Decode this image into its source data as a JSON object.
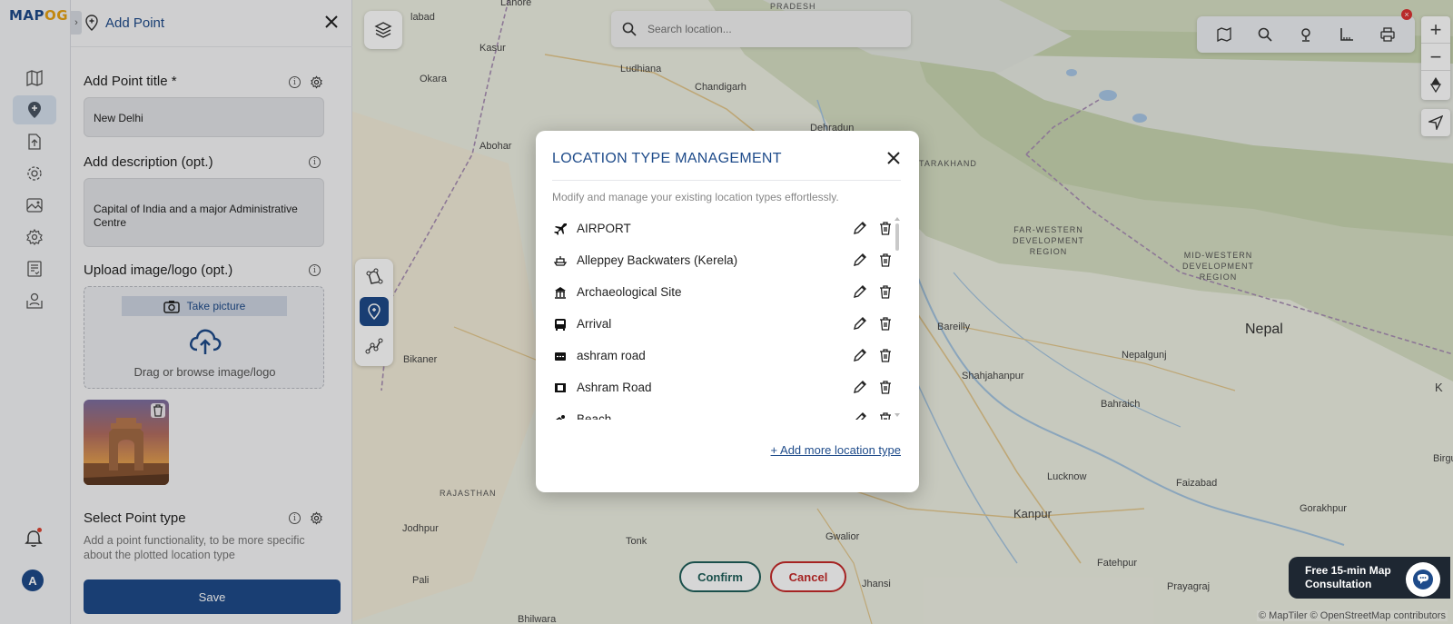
{
  "app": {
    "logo_main": "MAP",
    "logo_accent": "OG"
  },
  "rail": {
    "items": [
      {
        "name": "map-icon"
      },
      {
        "name": "add-point-icon"
      },
      {
        "name": "upload-icon"
      },
      {
        "name": "settings-icon"
      },
      {
        "name": "gallery-icon"
      },
      {
        "name": "preferences-icon"
      },
      {
        "name": "report-icon"
      },
      {
        "name": "map-user-icon"
      }
    ],
    "avatar_initial": "A"
  },
  "panel": {
    "title": "Add Point",
    "point_title_label": "Add Point title *",
    "point_title_value": "New Delhi",
    "description_label": "Add description (opt.)",
    "description_value": "Capital of India and a major Administrative Centre",
    "upload_label": "Upload image/logo (opt.)",
    "take_picture": "Take picture",
    "drag_browse": "Drag or browse image/logo",
    "point_type_label": "Select Point type",
    "point_type_note": "Add a point functionality, to be more specific about the plotted location type",
    "save_label": "Save"
  },
  "map": {
    "search_placeholder": "Search location...",
    "confirm_label": "Confirm",
    "cancel_label": "Cancel",
    "consult_line1": "Free 15-min Map",
    "consult_line2": "Consultation",
    "attribution": "© MapTiler © OpenStreetMap contributors",
    "places": {
      "lahore": "Lahore",
      "pradesh": "PRADESH",
      "faisalabad": "labad",
      "kasur": "Kasur",
      "ludhiana": "Ludhiana",
      "okara": "Okara",
      "chandigarh": "Chandigarh",
      "abohar": "Abohar",
      "dehradun": "Dehradun",
      "uttarakhand": "TARAKHAND",
      "far_western": "FAR-WESTERN\nDEVELOPMENT\nREGION",
      "mid_western": "MID-WESTERN\nDEVELOPMENT\nREGION",
      "nepal": "Nepal",
      "bareilly": "Bareilly",
      "nepalgunj": "Nepalgunj",
      "shahjahanpur": "Shahjahanpur",
      "bahraich": "Bahraich",
      "bikaner": "Bikaner",
      "rajasthan": "RAJASTHAN",
      "lucknow": "Lucknow",
      "faizabad": "Faizabad",
      "gorakhpur": "Gorakhpur",
      "birgunj": "Birgunj",
      "kanpur": "Kanpur",
      "jodhpur": "Jodhpur",
      "tonk": "Tonk",
      "gwalior": "Gwalior",
      "fatehpur": "Fatehpur",
      "pali": "Pali",
      "bhilwara": "Bhilwara",
      "jhansi": "Jhansi",
      "prayagraj": "Prayagraj",
      "k_edge": "K"
    }
  },
  "modal": {
    "title": "LOCATION TYPE MANAGEMENT",
    "subtitle": "Modify and manage your existing location types effortlessly.",
    "items": [
      {
        "label": "AIRPORT",
        "icon": "airplane-icon"
      },
      {
        "label": "Alleppey Backwaters (Kerela)",
        "icon": "boat-icon"
      },
      {
        "label": "Archaeological Site",
        "icon": "monument-icon"
      },
      {
        "label": "Arrival",
        "icon": "bus-icon"
      },
      {
        "label": "ashram road",
        "icon": "road-icon"
      },
      {
        "label": "Ashram Road",
        "icon": "film-icon"
      },
      {
        "label": "Beach",
        "icon": "swimmer-icon"
      }
    ],
    "add_more": "+ Add more location type"
  }
}
